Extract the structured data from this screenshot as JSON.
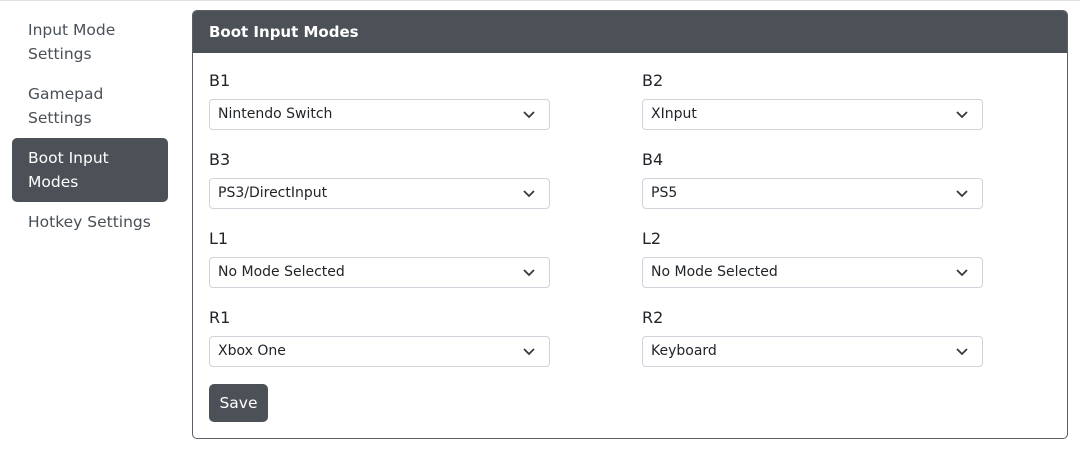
{
  "sidebar": {
    "items": [
      {
        "label": "Input Mode Settings",
        "line1": "Input Mode",
        "line2": "Settings",
        "active": false
      },
      {
        "label": "Gamepad Settings",
        "line1": "Gamepad",
        "line2": "Settings",
        "active": false
      },
      {
        "label": "Boot Input Modes",
        "line1": "Boot Input",
        "line2": "Modes",
        "active": true
      },
      {
        "label": "Hotkey Settings",
        "line1": "Hotkey Settings",
        "line2": "",
        "active": false
      }
    ]
  },
  "card": {
    "title": "Boot Input Modes"
  },
  "fields": {
    "b1": {
      "label": "B1",
      "value": "Nintendo Switch"
    },
    "b2": {
      "label": "B2",
      "value": "XInput"
    },
    "b3": {
      "label": "B3",
      "value": "PS3/DirectInput"
    },
    "b4": {
      "label": "B4",
      "value": "PS5"
    },
    "l1": {
      "label": "L1",
      "value": "No Mode Selected"
    },
    "l2": {
      "label": "L2",
      "value": "No Mode Selected"
    },
    "r1": {
      "label": "R1",
      "value": "Xbox One"
    },
    "r2": {
      "label": "R2",
      "value": "Keyboard"
    }
  },
  "actions": {
    "save_label": "Save"
  },
  "icons": {
    "select": "chevron-down-icon"
  },
  "colors": {
    "accent": "#4c5157",
    "border": "#ced4da"
  }
}
